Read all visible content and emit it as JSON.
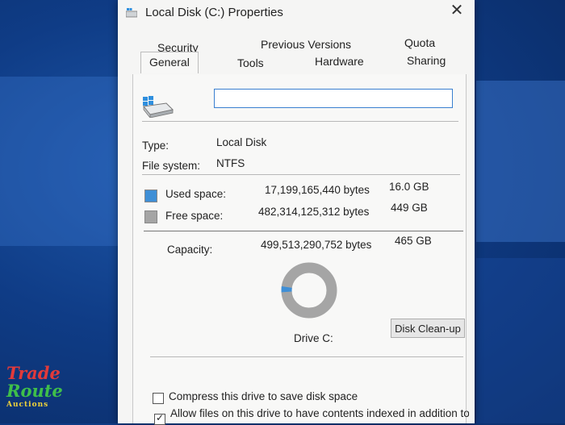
{
  "window": {
    "title": "Local Disk (C:) Properties",
    "close_glyph": "✕",
    "title_icon": "drive-icon"
  },
  "tabs": {
    "row1": [
      "Security",
      "Previous Versions",
      "Quota"
    ],
    "row2": [
      "General",
      "Tools",
      "Hardware",
      "Sharing"
    ],
    "active": "General"
  },
  "general": {
    "name_value": "",
    "drive_icon": "hard-drive-icon",
    "type_label": "Type:",
    "type_value": "Local Disk",
    "fs_label": "File system:",
    "fs_value": "NTFS",
    "used": {
      "label": "Used space:",
      "bytes": "17,199,165,440 bytes",
      "size": "16.0 GB",
      "color": "#3f8fd6"
    },
    "free": {
      "label": "Free space:",
      "bytes": "482,314,125,312 bytes",
      "size": "449 GB",
      "color": "#a5a5a5"
    },
    "capacity": {
      "label": "Capacity:",
      "bytes": "499,513,290,752 bytes",
      "size": "465 GB"
    },
    "used_fraction": 0.0344,
    "drive_label": "Drive C:",
    "cleanup_label": "Disk Clean-up",
    "compress_label": "Compress this drive to save disk space",
    "compress_checked": false,
    "index_label": "Allow files on this drive to have contents indexed in addition to",
    "index_checked": true
  },
  "watermark": {
    "line1": "Trade",
    "line2": "Route",
    "line3": "Auctions"
  }
}
